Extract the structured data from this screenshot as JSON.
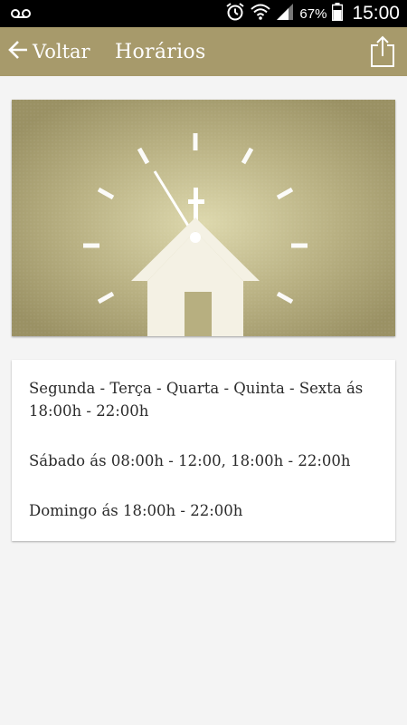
{
  "status_bar": {
    "icons": [
      "voicemail-icon",
      "alarm-icon",
      "wifi-icon",
      "signal-icon",
      "battery-icon"
    ],
    "battery_percent": "67%",
    "time": "15:00"
  },
  "app_bar": {
    "back_label": "Voltar",
    "title": "Horários",
    "back_icon": "arrow-left-icon",
    "share_icon": "share-icon",
    "color": "#a79a6b"
  },
  "hero": {
    "icon": "church-clock-illustration",
    "color": "#b0a878"
  },
  "schedule": {
    "lines": [
      "Segunda - Terça - Quarta - Quinta - Sexta ás 18:00h - 22:00h",
      "Sábado ás 08:00h - 12:00, 18:00h - 22:00h",
      "Domingo ás 18:00h - 22:00h"
    ]
  }
}
